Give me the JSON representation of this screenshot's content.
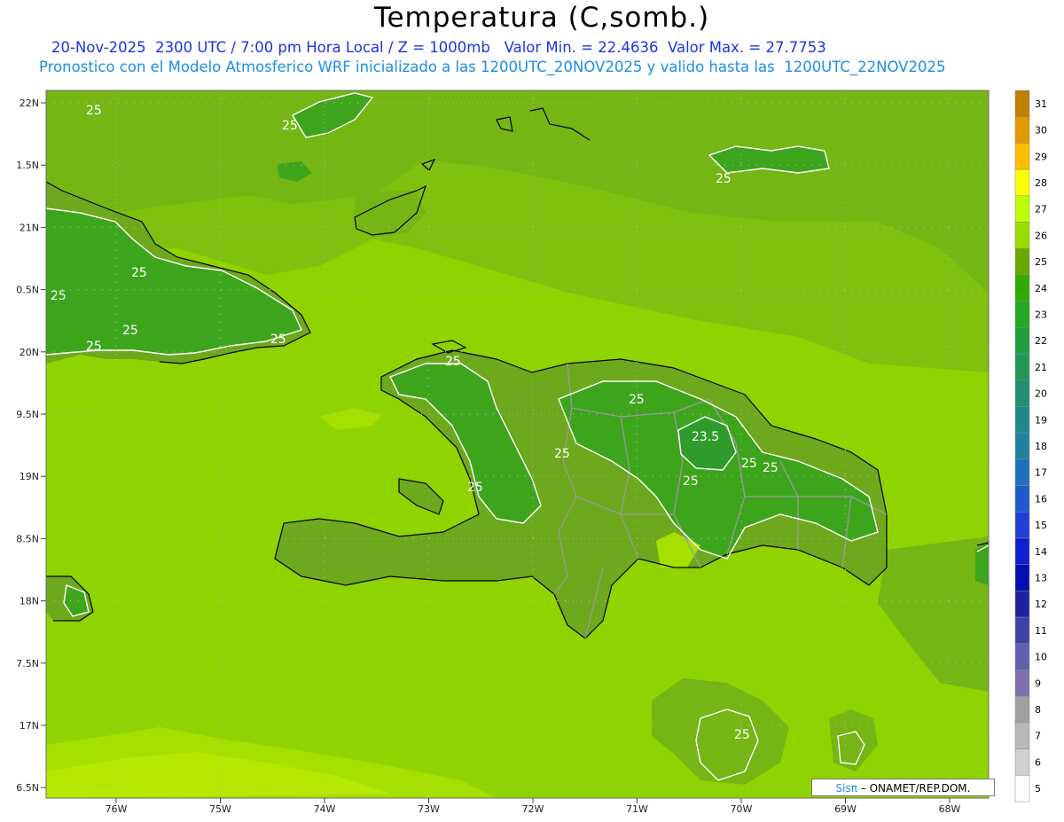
{
  "header": {
    "title": "Temperatura (C,somb.)",
    "line1": "20-Nov-2025  2300 UTC / 7:00 pm Hora Local / Z = 1000mb   Valor Min. = 22.4636  Valor Max. = 27.7753",
    "line2": "Pronostico con el Modelo Atmosferico WRF inicializado a las 1200UTC_20NOV2025 y valido hasta las  1200UTC_22NOV2025"
  },
  "axes": {
    "lat_labels": [
      "22N",
      "1.5N",
      "21N",
      "0.5N",
      "20N",
      "9.5N",
      "19N",
      "8.5N",
      "18N",
      "7.5N",
      "17N",
      "6.5N"
    ],
    "lon_labels": [
      "76W",
      "75W",
      "74W",
      "73W",
      "72W",
      "71W",
      "70W",
      "69W",
      "68W"
    ]
  },
  "contour_labels": [
    "25",
    "25",
    "25",
    "25",
    "25",
    "25",
    "25",
    "25",
    "25",
    "25",
    "25",
    "25",
    "23.5",
    "25",
    "25",
    "25",
    "25"
  ],
  "colorbar": {
    "levels": [
      "31",
      "30",
      "29",
      "28",
      "27",
      "26",
      "25",
      "24",
      "23",
      "22",
      "21",
      "20",
      "19",
      "18",
      "17",
      "16",
      "15",
      "14",
      "13",
      "12",
      "11",
      "10",
      "9",
      "8",
      "7",
      "6",
      "5"
    ],
    "colors": [
      "#c08000",
      "#e09a00",
      "#ffbf00",
      "#ffff00",
      "#bfff00",
      "#99dd00",
      "#66aa00",
      "#33aa00",
      "#22aa22",
      "#20a040",
      "#209958",
      "#209070",
      "#208888",
      "#2080a0",
      "#2070c0",
      "#2058d0",
      "#2040d8",
      "#1020d0",
      "#0010b0",
      "#2020a0",
      "#4040a8",
      "#6060b0",
      "#8070b0",
      "#a0a0a0",
      "#b8b8b8",
      "#d0d0d0",
      "#ffffff"
    ]
  },
  "field_colors": {
    "ocean_main": "#8fd400",
    "ocean_warm": "#a6e000",
    "cooler_land": "#6ea81c",
    "cool_core": "#3da51c",
    "coldest": "#2f9b2a"
  },
  "credit": {
    "logo": "Sisπ",
    "text": " – ONAMET/REP.DOM."
  }
}
